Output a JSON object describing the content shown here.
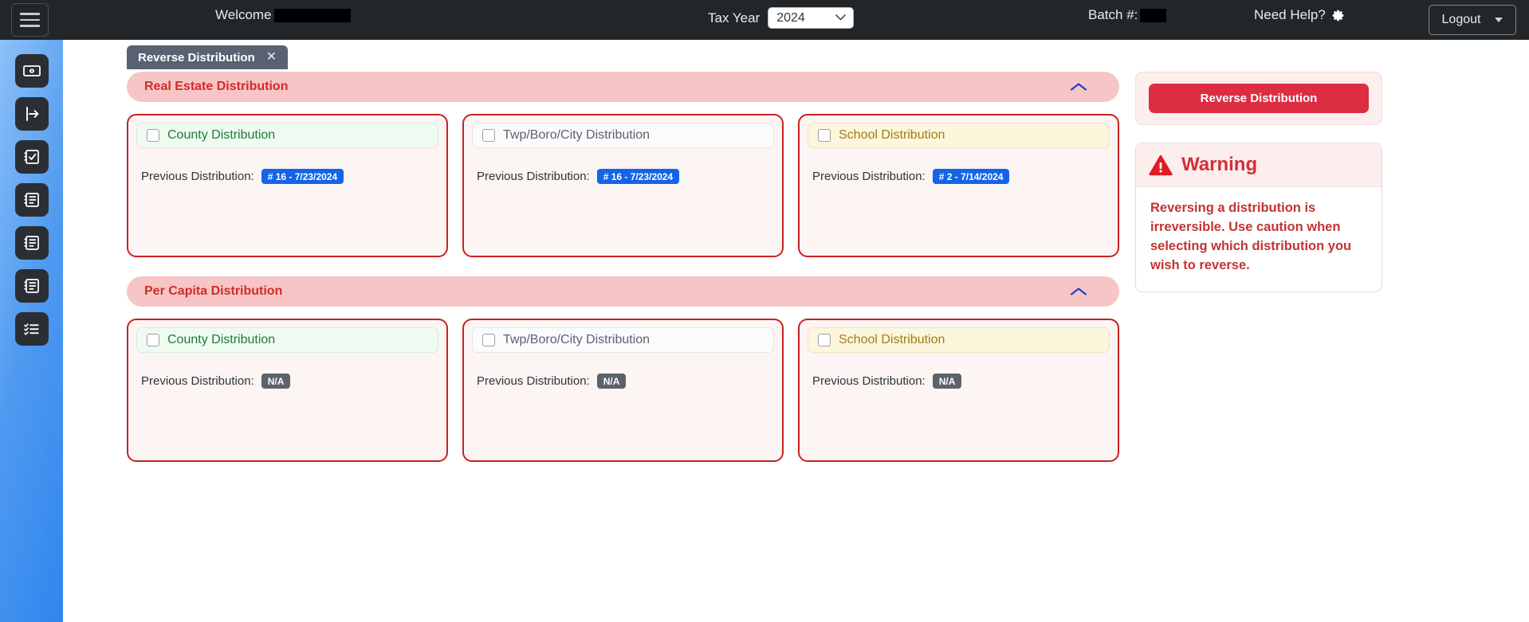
{
  "topbar": {
    "hamburger_icon": "hamburger-menu-icon",
    "welcome_label": "Welcome",
    "welcome_value_redacted": true,
    "welcome_redacted_width": 96,
    "tax_year_label": "Tax Year",
    "tax_year_value": "2024",
    "tax_year_options": [
      "2024"
    ],
    "batch_label": "Batch #:",
    "batch_value_redacted": true,
    "batch_redacted_width": 33,
    "help_label": "Need Help?",
    "help_icon": "gear-icon",
    "logout_label": "Logout"
  },
  "sidebar": {
    "items": [
      {
        "icon": "money-bill-icon",
        "name": "sidebar-item-billing"
      },
      {
        "icon": "arrow-right-from-bracket-icon",
        "name": "sidebar-item-distribution"
      },
      {
        "icon": "clipboard-check-icon",
        "name": "sidebar-item-reconcile"
      },
      {
        "icon": "document-list-icon",
        "name": "sidebar-item-reports-1"
      },
      {
        "icon": "document-list-icon",
        "name": "sidebar-item-reports-2"
      },
      {
        "icon": "document-list-icon",
        "name": "sidebar-item-reports-3"
      },
      {
        "icon": "checklist-icon",
        "name": "sidebar-item-tasks"
      }
    ]
  },
  "tabs": [
    {
      "label": "Reverse Distribution",
      "close_icon": "close-icon",
      "active": true
    }
  ],
  "sections": [
    {
      "title": "Real Estate Distribution",
      "collapse_icon": "chevron-up-icon",
      "cards": [
        {
          "name": "county-distribution",
          "theme": "green",
          "label": "County Distribution",
          "checked": false,
          "prev_label": "Previous Distribution:",
          "badge_text": "# 16 - 7/23/2024",
          "badge_style": "blue"
        },
        {
          "name": "twp-boro-city-distribution",
          "theme": "neutral",
          "label": "Twp/Boro/City Distribution",
          "checked": false,
          "prev_label": "Previous Distribution:",
          "badge_text": "# 16 - 7/23/2024",
          "badge_style": "blue"
        },
        {
          "name": "school-distribution",
          "theme": "amber",
          "label": "School Distribution",
          "checked": false,
          "prev_label": "Previous Distribution:",
          "badge_text": "# 2 - 7/14/2024",
          "badge_style": "blue"
        }
      ]
    },
    {
      "title": "Per Capita Distribution",
      "collapse_icon": "chevron-up-icon",
      "cards": [
        {
          "name": "county-distribution",
          "theme": "green",
          "label": "County Distribution",
          "checked": false,
          "prev_label": "Previous Distribution:",
          "badge_text": "N/A",
          "badge_style": "gray"
        },
        {
          "name": "twp-boro-city-distribution",
          "theme": "neutral",
          "label": "Twp/Boro/City Distribution",
          "checked": false,
          "prev_label": "Previous Distribution:",
          "badge_text": "N/A",
          "badge_style": "gray"
        },
        {
          "name": "school-distribution",
          "theme": "amber",
          "label": "School Distribution",
          "checked": false,
          "prev_label": "Previous Distribution:",
          "badge_text": "N/A",
          "badge_style": "gray"
        }
      ]
    }
  ],
  "right_panel": {
    "reverse_button_label": "Reverse Distribution",
    "warning_icon": "warning-triangle-icon",
    "warning_title": "Warning",
    "warning_text": "Reversing a distribution is irreversible. Use caution when selecting which distribution you wish to reverse."
  },
  "colors": {
    "brand_red": "#dc2d41",
    "card_border_red": "#c62222",
    "section_pill": "#f7c5c5",
    "section_title": "#d12b2b",
    "badge_blue": "#1464e8",
    "badge_gray": "#5c636a",
    "topbar_bg": "#222629",
    "sidebar_blue": "#2f86ee"
  }
}
